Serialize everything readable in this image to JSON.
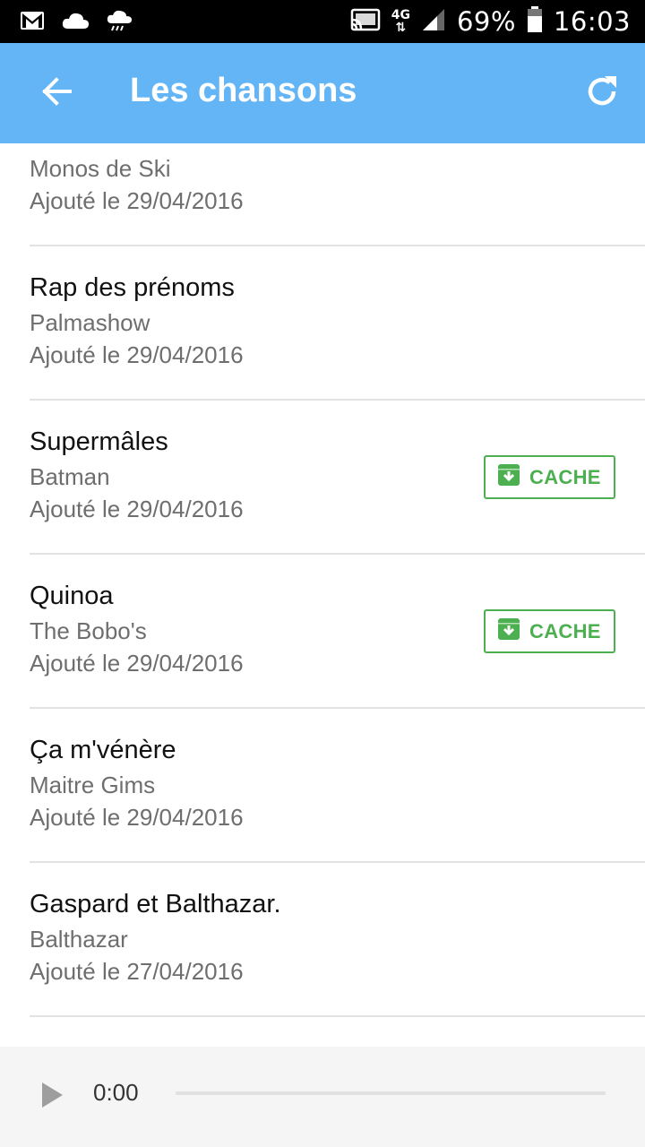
{
  "status_bar": {
    "battery_text": "69%",
    "time": "16:03",
    "network": "4G",
    "icons": [
      "gmail-icon",
      "cloud-icon",
      "weather-cloud-icon",
      "cast-icon",
      "signal-icon",
      "battery-icon"
    ]
  },
  "app_bar": {
    "title": "Les chansons",
    "background": "#64b5f6",
    "back_icon": "arrow-back-icon",
    "refresh_icon": "refresh-icon"
  },
  "songs": [
    {
      "title": "Monos de Ski",
      "artist": "Monos de Ski",
      "date": "Ajouté le 29/04/2016",
      "cached": false
    },
    {
      "title": "Rap des prénoms",
      "artist": "Palmashow",
      "date": "Ajouté le 29/04/2016",
      "cached": false
    },
    {
      "title": "Supermâles",
      "artist": "Batman",
      "date": "Ajouté le 29/04/2016",
      "cached": true
    },
    {
      "title": "Quinoa",
      "artist": "The Bobo's",
      "date": "Ajouté le 29/04/2016",
      "cached": true
    },
    {
      "title": "Ça m'vénère",
      "artist": "Maitre Gims",
      "date": "Ajouté le 29/04/2016",
      "cached": false
    },
    {
      "title": "Gaspard et Balthazar.",
      "artist": "Balthazar",
      "date": "Ajouté le 27/04/2016",
      "cached": false
    }
  ],
  "cache_label": "CACHE",
  "cache_color": "#4caf50",
  "player": {
    "time": "0:00",
    "progress": 0
  }
}
